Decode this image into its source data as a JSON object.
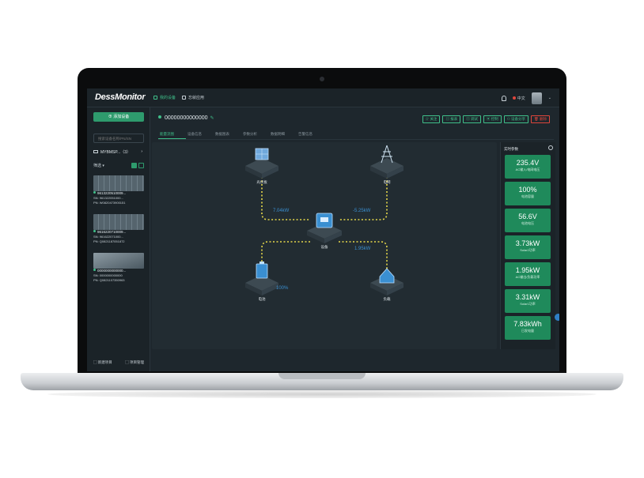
{
  "app": {
    "logo": "DessMonitor",
    "nav": [
      {
        "label": "我的设备",
        "active": true
      },
      {
        "label": "忘就应用",
        "active": false
      }
    ],
    "language": "中文"
  },
  "sidebar": {
    "add_device": "添加设备",
    "search_placeholder": "搜索设备名称/PN/SN",
    "group_label": "MYBMSP...（3）",
    "filter_label": "筛选",
    "devices": [
      {
        "name": "9613220510009...",
        "sn": "SN: 961322051000...",
        "pn": "PN: W0820473900151"
      },
      {
        "name": "9616220710009...",
        "sn": "SN: 961622071000...",
        "pn": "PN: Q0821187051872"
      },
      {
        "name": "0000000000000...",
        "sn": "SN: 0000000000000",
        "pn": "PN: Q0821107350963"
      }
    ],
    "footer_left": "新建项目",
    "footer_right": "项目管理"
  },
  "device": {
    "title": "00000000000000",
    "actions": [
      "关注",
      "报表",
      "调试",
      "控制",
      "设备分享",
      "删除"
    ],
    "tabs": [
      "能量流图",
      "设备信息",
      "数据图表",
      "参数分析",
      "数据明细",
      "告警信息"
    ],
    "active_tab": 0
  },
  "flow": {
    "nodes": {
      "pv": "光伏板",
      "grid": "电网",
      "device": "设备",
      "battery": "电池",
      "load": "负载"
    },
    "powers": {
      "pv": "7.04kW",
      "grid": "-5.25kW",
      "load": "1.95kW",
      "battery_soc": "100%"
    }
  },
  "realtime": {
    "title": "实时参数",
    "cards": [
      {
        "value": "235.4V",
        "label": "AC输入/电网电压"
      },
      {
        "value": "100%",
        "label": "电池容量"
      },
      {
        "value": "56.6V",
        "label": "电池电压"
      },
      {
        "value": "3.73kW",
        "label": "Solar2功率"
      },
      {
        "value": "1.95kW",
        "label": "AC输出/负载功率"
      },
      {
        "value": "3.31kW",
        "label": "Solar1功率"
      },
      {
        "value": "7.83kWh",
        "label": "日发电量"
      }
    ]
  },
  "colors": {
    "accent": "#3fc08a",
    "card": "#1f8a5b",
    "flow_line": "#e6d84a",
    "power_text": "#3a8fd1",
    "danger": "#e0463c"
  }
}
